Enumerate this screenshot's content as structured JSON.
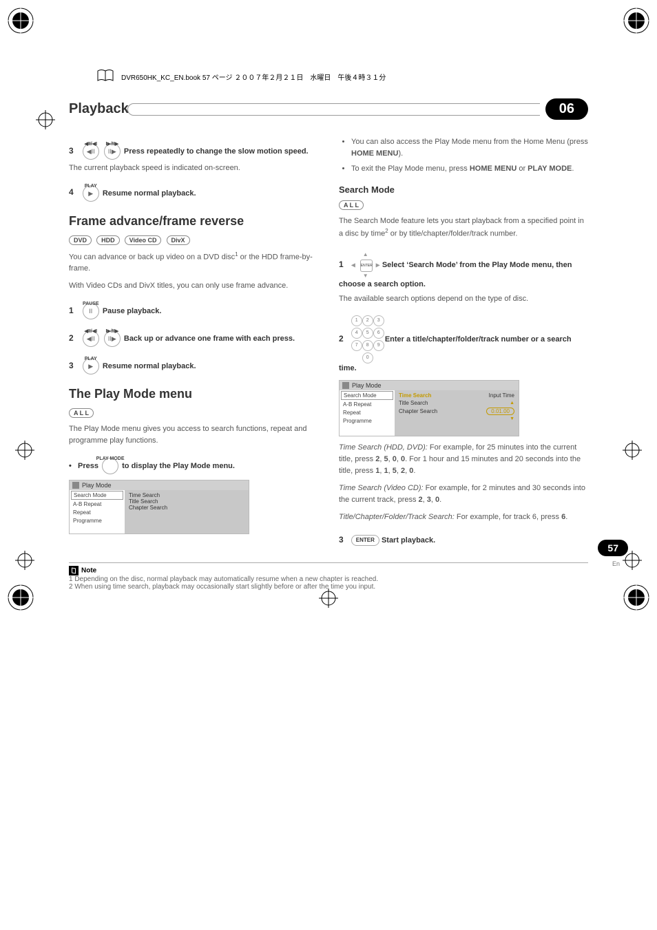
{
  "book_header": "DVR650HK_KC_EN.book  57 ページ  ２００７年２月２１日　水曜日　午後４時３１分",
  "section": {
    "title": "Playback",
    "chapter": "06"
  },
  "left": {
    "step3a": {
      "num": "3",
      "btn1_label": "◀II/◀I",
      "btn1_glyph": "◀II",
      "btn2_label": "I▶/II▶",
      "btn2_glyph": "II▶",
      "text": "Press repeatedly to change the slow motion speed."
    },
    "step3a_desc": "The current playback speed is indicated on-screen.",
    "step4": {
      "num": "4",
      "btn_label": "PLAY",
      "btn_glyph": "▶",
      "text": "Resume normal playback."
    },
    "h_frame": "Frame advance/frame reverse",
    "media1": [
      "DVD",
      "HDD",
      "Video CD",
      "DivX"
    ],
    "frame_p1a": "You can advance or back up video on a DVD disc",
    "frame_p1b": " or the HDD frame-by-frame.",
    "frame_p2": "With Video CDs and DivX titles, you can only use frame advance.",
    "f_step1": {
      "num": "1",
      "btn_label": "PAUSE",
      "btn_glyph": "II",
      "text": "Pause playback."
    },
    "f_step2": {
      "num": "2",
      "btn1_label": "◀II/◀I",
      "btn1_glyph": "◀II",
      "btn2_label": "I▶/II▶",
      "btn2_glyph": "II▶",
      "text": "Back up or advance one frame with each press."
    },
    "f_step3": {
      "num": "3",
      "btn_label": "PLAY",
      "btn_glyph": "▶",
      "text": "Resume normal playback."
    },
    "h_play": "The Play Mode menu",
    "all_pill": "A L L",
    "play_p1": "The Play Mode menu gives you access to search functions, repeat and programme play functions.",
    "play_press": {
      "lead": "Press",
      "btn_label": "PLAY MODE",
      "tail": "to display the Play Mode menu."
    },
    "ui1": {
      "header": "Play Mode",
      "left": [
        "Search Mode",
        "A-B Repeat",
        "Repeat",
        "Programme"
      ],
      "right": [
        "Time Search",
        "Title Search",
        "Chapter Search"
      ]
    }
  },
  "right": {
    "bullets": [
      {
        "a": "You can also access the Play Mode menu from the Home Menu (press ",
        "b": "HOME MENU",
        "c": ")."
      },
      {
        "a": "To exit the Play Mode menu, press ",
        "b": "HOME MENU",
        "c": " or ",
        "d": "PLAY MODE",
        "e": "."
      }
    ],
    "h_search": "Search Mode",
    "all_pill": "A L L",
    "search_p1a": "The Search Mode feature lets you start playback from a specified point in a disc by time",
    "search_p1b": " or by title/chapter/folder/track number.",
    "s_step1": {
      "num": "1",
      "btn_label": "ENTER",
      "text": "Select ‘Search Mode’ from the Play Mode menu, then choose a search option."
    },
    "s_step1_desc": "The available search options depend on the type of disc.",
    "s_step2": {
      "num": "2",
      "text": "Enter a title/chapter/folder/track number or a search time."
    },
    "ui2": {
      "header": "Play Mode",
      "left": [
        "Search Mode",
        "A-B Repeat",
        "Repeat",
        "Programme"
      ],
      "right_col1": [
        "Time Search",
        "Title Search",
        "Chapter Search"
      ],
      "right_head": "Input Time",
      "time": "0.01.00"
    },
    "ex1": {
      "label": "Time Search (HDD, DVD):",
      "a": " For example, for 25 minutes into the current title, press ",
      "k1": "2",
      "k2": "5",
      "k3": "0",
      "k4": "0",
      "b": ". For 1 hour and 15 minutes and 20 seconds into the title, press ",
      "k5": "1",
      "k6": "1",
      "k7": "5",
      "k8": "2",
      "k9": "0",
      "c": "."
    },
    "ex2": {
      "label": "Time Search (Video CD):",
      "a": " For example, for 2 minutes and 30 seconds into the current track, press ",
      "k1": "2",
      "k2": "3",
      "k3": "0",
      "b": "."
    },
    "ex3": {
      "label": "Title/Chapter/Folder/Track Search:",
      "a": " For example, for track 6, press ",
      "k1": "6",
      "b": "."
    },
    "s_step3": {
      "num": "3",
      "btn": "ENTER",
      "text": "Start playback."
    }
  },
  "notes": {
    "title": "Note",
    "n1": "1 Depending on the disc, normal playback may automatically resume when a new chapter is reached.",
    "n2": "2 When using time search, playback may occasionally start slightly before or after the time you input."
  },
  "page_number": "57",
  "page_lang": "En"
}
